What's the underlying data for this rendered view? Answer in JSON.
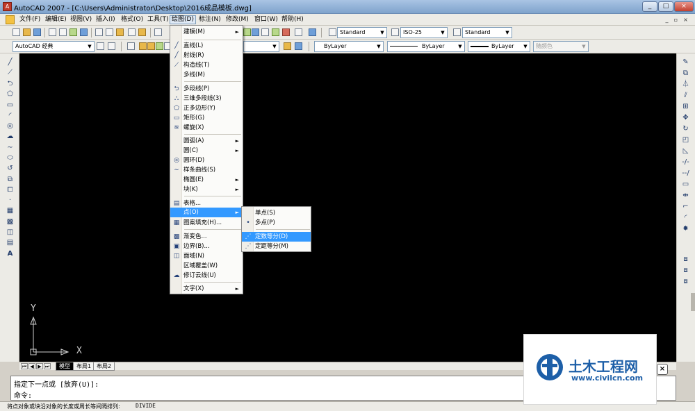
{
  "window": {
    "title": "AutoCAD 2007 - [C:\\Users\\Administrator\\Desktop\\2016成品模板.dwg]",
    "app_icon": "autocad-logo-icon",
    "minimize": "_",
    "maximize": "□",
    "close": "×",
    "doc_minimize": "_",
    "doc_restore": "▫",
    "doc_close": "×"
  },
  "menubar": {
    "items": [
      "文件(F)",
      "编辑(E)",
      "视图(V)",
      "插入(I)",
      "格式(O)",
      "工具(T)",
      "绘图(D)",
      "标注(N)",
      "修改(M)",
      "窗口(W)",
      "帮助(H)"
    ],
    "active": "绘图(D)"
  },
  "toolbar1": {
    "text_style": "Standard",
    "dim_style": "ISO-25",
    "table_style": "Standard"
  },
  "toolbar2": {
    "workspace": "AutoCAD 经典",
    "color": "ByLayer",
    "linetype": "ByLayer",
    "lineweight": "ByLayer",
    "plotstyle": "随颜色"
  },
  "draw_menu": {
    "items": [
      {
        "label": "建模(M)",
        "icon": "",
        "submenu": true
      },
      {
        "label": "直线(L)",
        "icon": "line-icon",
        "submenu": false
      },
      {
        "label": "射线(R)",
        "icon": "ray-icon",
        "submenu": false
      },
      {
        "label": "构造线(T)",
        "icon": "xline-icon",
        "submenu": false
      },
      {
        "label": "多线(M)",
        "icon": "",
        "submenu": false
      },
      {
        "label": "多段线(P)",
        "icon": "polyline-icon",
        "submenu": false
      },
      {
        "label": "三维多段线(3)",
        "icon": "3dpoly-icon",
        "submenu": false
      },
      {
        "label": "正多边形(Y)",
        "icon": "polygon-icon",
        "submenu": false
      },
      {
        "label": "矩形(G)",
        "icon": "rectangle-icon",
        "submenu": false
      },
      {
        "label": "螺旋(X)",
        "icon": "helix-icon",
        "submenu": false
      },
      {
        "label": "圆弧(A)",
        "icon": "",
        "submenu": true
      },
      {
        "label": "圆(C)",
        "icon": "",
        "submenu": true
      },
      {
        "label": "圆环(D)",
        "icon": "donut-icon",
        "submenu": false
      },
      {
        "label": "样条曲线(S)",
        "icon": "spline-icon",
        "submenu": false
      },
      {
        "label": "椭圆(E)",
        "icon": "",
        "submenu": true
      },
      {
        "label": "块(K)",
        "icon": "",
        "submenu": true
      },
      {
        "label": "表格...",
        "icon": "table-icon",
        "submenu": false
      },
      {
        "label": "点(O)",
        "icon": "",
        "submenu": true
      },
      {
        "label": "图案填充(H)...",
        "icon": "hatch-icon",
        "submenu": false
      },
      {
        "label": "渐变色...",
        "icon": "gradient-icon",
        "submenu": false
      },
      {
        "label": "边界(B)...",
        "icon": "boundary-icon",
        "submenu": false
      },
      {
        "label": "面域(N)",
        "icon": "region-icon",
        "submenu": false
      },
      {
        "label": "区域覆盖(W)",
        "icon": "",
        "submenu": false
      },
      {
        "label": "修订云线(U)",
        "icon": "revcloud-icon",
        "submenu": false
      },
      {
        "label": "文字(X)",
        "icon": "",
        "submenu": true
      }
    ],
    "highlighted": "点(O)"
  },
  "point_submenu": {
    "items": [
      {
        "label": "单点(S)",
        "icon": ""
      },
      {
        "label": "多点(P)",
        "icon": "point-icon"
      },
      {
        "label": "定数等分(D)",
        "icon": "divide-icon"
      },
      {
        "label": "定距等分(M)",
        "icon": "measure-icon"
      }
    ],
    "highlighted": "定数等分(D)"
  },
  "canvas": {
    "background": "#000000",
    "ucs_x": "X",
    "ucs_y": "Y"
  },
  "layout_tabs": {
    "tabs": [
      "模型",
      "布局1",
      "布局2"
    ],
    "active": "模型"
  },
  "command": {
    "line1": "指定下一点或 [放弃(U)]:",
    "line2": "命令:"
  },
  "statusbar": {
    "text": "将点对象或块沿对象的长度或周长等间隔排列:",
    "command": "DIVIDE"
  },
  "watermark": {
    "cn": "土木工程网",
    "url": "www.civilcn.com",
    "close": "×"
  },
  "colors": {
    "highlight": "#3399ff",
    "canvas": "#000000",
    "brand": "#1d5fa8"
  }
}
